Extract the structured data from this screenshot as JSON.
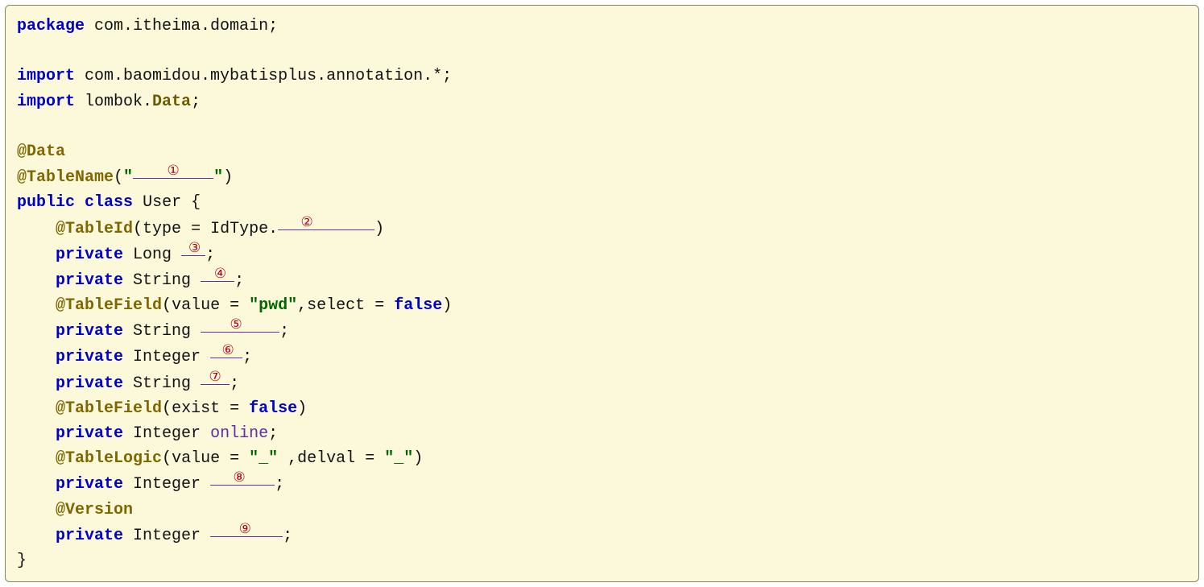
{
  "code": {
    "package_kw": "package",
    "package_path": "com.itheima.domain",
    "import_kw": "import",
    "import1_pkg": "com.baomidou.mybatisplus.annotation.*",
    "import2_pkg_prefix": "lombok.",
    "import2_pkg_cls": "Data",
    "ann_data": "@Data",
    "ann_tablename": "@TableName",
    "ann_tableid": "@TableId",
    "ann_tablefield": "@TableField",
    "ann_tablelogic": "@TableLogic",
    "ann_version": "@Version",
    "public_kw": "public",
    "class_kw": "class",
    "class_name": "User",
    "private_kw": "private",
    "type_long": "Long",
    "type_string": "String",
    "type_integer": "Integer",
    "idtype_prefix": "IdType.",
    "tableid_type_label": "type",
    "tf_value_label": "value",
    "tf_select_label": "select",
    "tf_exist_label": "exist",
    "tl_value_label": "value",
    "tl_delval_label": "delval",
    "false_kw": "false",
    "str_pwd": "\"pwd\"",
    "str_underscore": "\"_\"",
    "tn_quote_open": "\"",
    "tn_quote_close": "\"",
    "field_online": "online",
    "blanks": {
      "b1": "①",
      "b2": "②",
      "b3": "③",
      "b4": "④",
      "b5": "⑤",
      "b6": "⑥",
      "b7": "⑦",
      "b8": "⑧",
      "b9": "⑨"
    },
    "punct": {
      "semi": ";",
      "lbrace": "{",
      "rbrace": "}",
      "lparen": "(",
      "rparen": ")",
      "eq": "=",
      "comma": ",",
      "dot": "."
    }
  },
  "blank_widths": {
    "b1": "100px",
    "b2": "120px",
    "b3": "30px",
    "b4": "42px",
    "b5": "98px",
    "b6": "40px",
    "b7": "36px",
    "b8": "80px",
    "b9": "90px"
  }
}
